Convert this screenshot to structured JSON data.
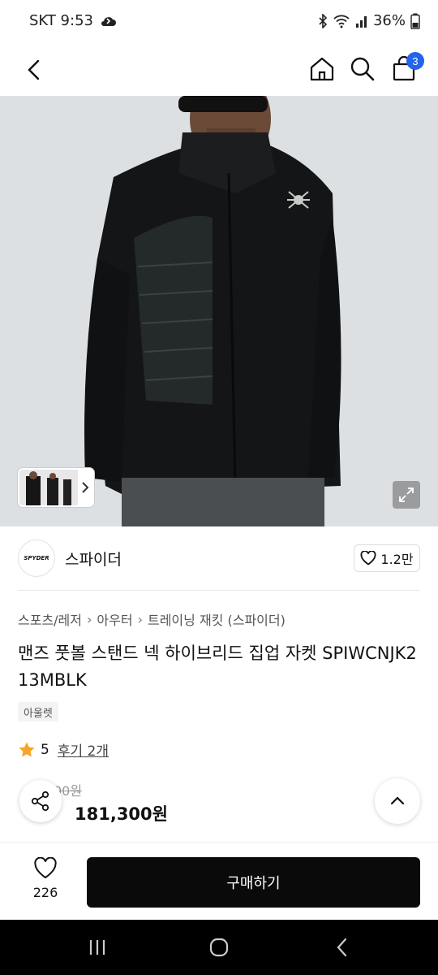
{
  "status_bar": {
    "carrier_time": "SKT 9:53",
    "battery": "36%"
  },
  "nav": {
    "cart_count": "3"
  },
  "brand": {
    "logo_text": "SPYDER",
    "name": "스파이더",
    "likes": "1.2만"
  },
  "breadcrumb": {
    "items": [
      "스포츠/레저",
      "아우터",
      "트레이닝 재킷 (스파이더)"
    ]
  },
  "product": {
    "title": "맨즈 풋볼 스탠드 넥 하이브리드 집업 자켓 SPIWCNJK213MBLK",
    "tag": "아울렛",
    "rating": "5",
    "reviews": "후기 2개",
    "original_price": "00원",
    "discount": "",
    "price": "181,300원"
  },
  "bottom": {
    "wish_count": "226",
    "buy_label": "구매하기"
  },
  "colors": {
    "accent": "#2563eb",
    "discount": "#e02020",
    "buy_button": "#0a0a0a",
    "star": "#f5a623"
  }
}
